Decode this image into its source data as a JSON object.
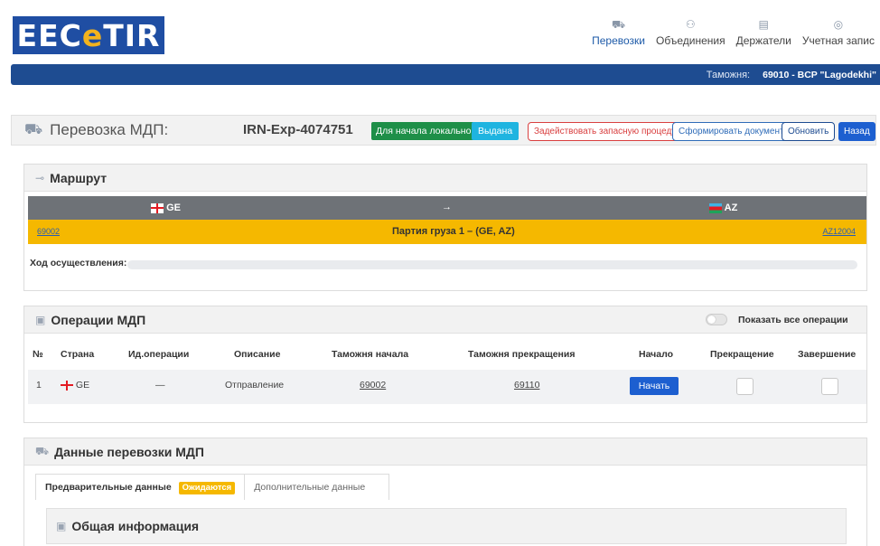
{
  "header": {
    "logo_prefix": "EEC",
    "logo_e": "e",
    "logo_suffix": "TIR",
    "nav": [
      {
        "label": "Перевозки",
        "icon": "transport-icon"
      },
      {
        "label": "Объединения",
        "icon": "associations-icon"
      },
      {
        "label": "Держатели",
        "icon": "holders-icon"
      },
      {
        "label": "Учетная запис",
        "icon": "account-icon"
      }
    ]
  },
  "customs_bar": {
    "label": "Таможня:",
    "value": "69010 - BCP \"Lagodekhi\""
  },
  "transport": {
    "title": "Перевозка МДП:",
    "irn": "IRN-Exp-4074751",
    "status_local": "Для начала локально",
    "status_issued": "Выдана",
    "btn_fallback": "Задействовать запасную процедуру",
    "btn_document": "Сформировать документ",
    "btn_refresh": "Обновить",
    "btn_back": "Назад"
  },
  "route": {
    "title": "Маршрут",
    "from_country": "GE",
    "arrow": "→",
    "to_country": "AZ",
    "from_code": "69002",
    "consignment": "Партия груза 1 – (GE, AZ)",
    "to_code": "AZ12004",
    "progress_label": "Ход осуществления:",
    "progress": 0
  },
  "operations": {
    "title": "Операции МДП",
    "show_all_label": "Показать все операции",
    "columns": [
      "№",
      "Страна",
      "Ид.операции",
      "Описание",
      "Таможня начала",
      "Таможня прекращения",
      "Начало",
      "Прекращение",
      "Завершение"
    ],
    "rows": [
      {
        "num": "1",
        "country": "GE",
        "op_id": "—",
        "description": "Отправление",
        "start_customs": "69002",
        "end_customs": "69110",
        "start_btn": "Начать"
      }
    ]
  },
  "transport_data": {
    "title": "Данные перевозки МДП",
    "tab_preliminary": "Предварительные данные",
    "tab_badge": "Ожидаются",
    "tab_additional": "Дополнительные данные",
    "general_info": "Общая информация"
  },
  "colors": {
    "brand_blue": "#1e4c91",
    "route_yellow": "#f5b800",
    "primary_button": "#1d5fd0",
    "success_green": "#1e8f48"
  }
}
